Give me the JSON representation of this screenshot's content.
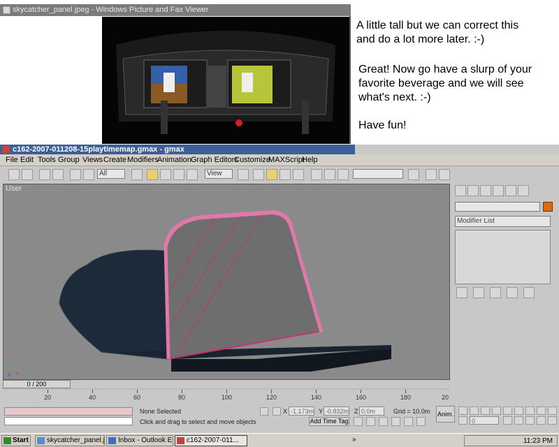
{
  "viewer": {
    "title": "skycatcher_panel.jpeg - Windows Picture and Fax Viewer"
  },
  "notes": {
    "line1": "A little tall but we can correct this",
    "line2": "and do a lot more later. :-)",
    "line3": "Great!  Now go have a slurp of your",
    "line4": "favorite beverage and we will see",
    "line5": "what's next. :-)",
    "line6": "Have fun!"
  },
  "gmax": {
    "title": "c162-2007-011208-15playtimemap.gmax - gmax",
    "menu": [
      "File",
      "Edit",
      "Tools",
      "Group",
      "Views",
      "Create",
      "Modifiers",
      "Animation",
      "Graph Editors",
      "Customize",
      "MAXScript",
      "Help"
    ],
    "toolbar": {
      "selection_filter": "All",
      "ref_coord": "View"
    },
    "viewport": {
      "label": "User"
    },
    "command_panel": {
      "modifier_list": "Modifier List"
    },
    "timeline": {
      "slider": "0 / 200",
      "ticks": [
        "20",
        "40",
        "60",
        "80",
        "100",
        "120",
        "140",
        "160",
        "180",
        "20"
      ]
    },
    "status": {
      "selection": "None Selected",
      "prompt": "Click and drag to select and move objects",
      "x_label": "X",
      "x_value": "-1.173m",
      "y_label": "Y",
      "y_value": "-0.832m",
      "z_label": "Z",
      "z_value": "0.0m",
      "grid": "Grid = 10.0m",
      "add_time_tag": "Add Time Tag",
      "anim": "Anim.",
      "frame": "0"
    }
  },
  "taskbar": {
    "start": "Start",
    "tasks": [
      "skycatcher_panel.jp...",
      "Inbox - Outlook E...",
      "c162-2007-011..."
    ],
    "clock": "11:23 PM"
  },
  "colors": {
    "gmax_title": "#3a5f99",
    "viewport_bg": "#8a8a8a",
    "mesh_wire": "#c8326e"
  }
}
